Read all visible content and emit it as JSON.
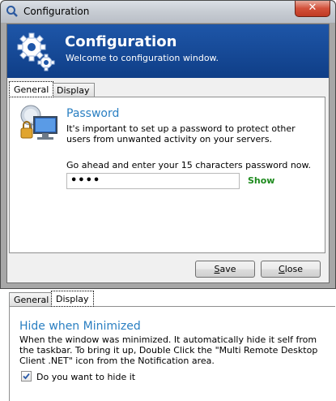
{
  "window": {
    "title": "Configuration",
    "close_glyph": "✕"
  },
  "banner": {
    "title": "Configuration",
    "subtitle": "Welcome to configuration window.",
    "icon": "gears-icon"
  },
  "tabs": [
    "General",
    "Display"
  ],
  "general": {
    "heading": "Password",
    "description": "It's important to set up a password to protect other users from unwanted activity on your servers.",
    "prompt": "Go ahead and enter your 15 characters password now.",
    "password_value": "••••",
    "show_label": "Show"
  },
  "buttons": {
    "save_label": "Save",
    "close_label": "Close"
  },
  "display": {
    "tabs": [
      "General",
      "Display"
    ],
    "heading": "Hide when Minimized",
    "description": "When the window was minimized. It automatically hide it self from the taskbar. To bring it up, Double Click the \"Multi Remote Desktop Client .NET\" icon from the Notification area.",
    "checkbox_label": "Do you want to hide it",
    "checkbox_checked": true,
    "check_glyph": "✓"
  },
  "colors": {
    "banner": "#1e56a8",
    "heading": "#2a7fc2",
    "show": "#1d8a1d"
  }
}
